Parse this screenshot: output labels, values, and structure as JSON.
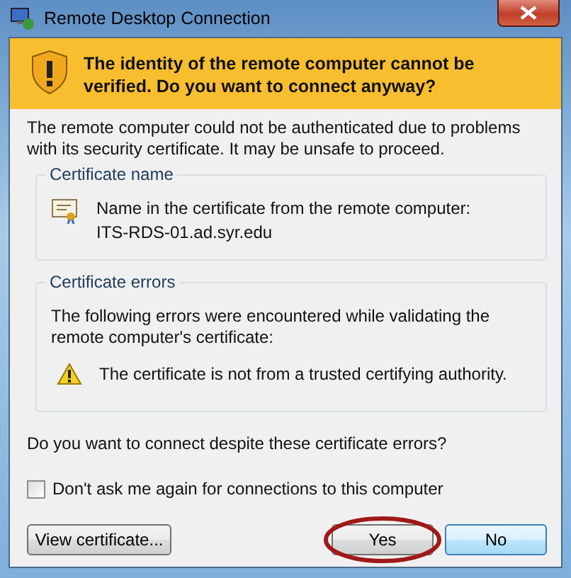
{
  "window": {
    "title": "Remote Desktop Connection"
  },
  "banner": {
    "heading": "The identity of the remote computer cannot be verified. Do you want to connect anyway?"
  },
  "message": "The remote computer could not be authenticated due to problems with its security certificate. It may be unsafe to proceed.",
  "groups": [
    {
      "kind": "name",
      "title": "Certificate name",
      "lines": [
        "Name in the certificate from the remote computer:",
        "ITS-RDS-01.ad.syr.edu"
      ]
    },
    {
      "kind": "errors",
      "title": "Certificate errors",
      "intro": "The following errors were encountered while validating the remote computer's certificate:",
      "errors": [
        "The certificate is not from a trusted certifying authority."
      ]
    }
  ],
  "question": "Do you want to connect despite these certificate errors?",
  "checkbox": {
    "label": "Don't ask me again for connections to this computer",
    "checked": false
  },
  "buttons": [
    {
      "label": "View certificate...",
      "default": false,
      "circled": false
    },
    {
      "label": "Yes",
      "default": false,
      "circled": true
    },
    {
      "label": "No",
      "default": true,
      "circled": false
    }
  ]
}
